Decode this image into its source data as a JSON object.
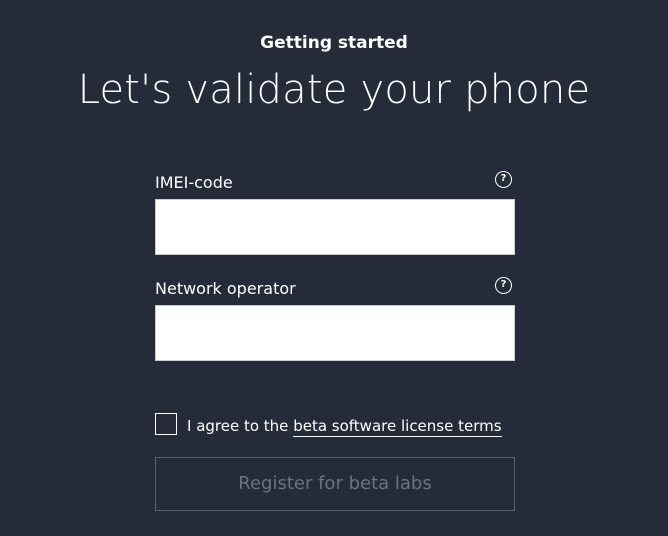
{
  "header": {
    "subtitle": "Getting started",
    "title": "Let's validate your phone"
  },
  "form": {
    "imei": {
      "label": "IMEI-code",
      "value": "",
      "help_icon": "question-mark-circle-icon",
      "help_glyph": "?"
    },
    "operator": {
      "label": "Network operator",
      "value": "",
      "help_icon": "question-mark-circle-icon",
      "help_glyph": "?"
    },
    "agreement": {
      "checked": false,
      "text_prefix": "I agree to the",
      "link_text": "beta software license terms"
    },
    "submit": {
      "label": "Register for beta labs",
      "disabled": true
    }
  },
  "colors": {
    "background": "#252b38",
    "text": "#ffffff",
    "disabled_text": "#6d727d",
    "disabled_border": "#5a5f6b"
  }
}
